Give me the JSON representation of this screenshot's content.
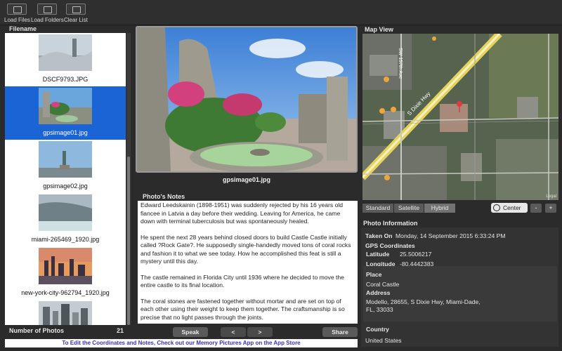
{
  "toolbar": {
    "load_files": "Load Files",
    "load_folders": "Load Folders",
    "clear_list": "Clear List"
  },
  "file_list": {
    "header": "Filename",
    "items": [
      {
        "name": "DSCF9793.JPG",
        "selected": false
      },
      {
        "name": "gpsimage01.jpg",
        "selected": true
      },
      {
        "name": "gpsimage02.jpg",
        "selected": false
      },
      {
        "name": "miami-265469_1920.jpg",
        "selected": false
      },
      {
        "name": "new-york-city-962794_1920.jpg",
        "selected": false
      },
      {
        "name": "",
        "selected": false
      }
    ],
    "count_label": "Number of Photos",
    "count_value": "21"
  },
  "photo": {
    "caption": "gpsimage01.jpg"
  },
  "notes": {
    "title": "Photo's Notes",
    "paragraphs": [
      "Edward Leedskainin (1898-1951) was suddenly rejected by his 16 years old fiancee  in Latvia a day before their wedding. Leaving for America, he came down with terminal tuberculosis but was spontaneously healed.",
      "He spent the next 28 years behind closed doors to build Castle Castle initially called ?Rock Gate?. He supposedly single-handedly moved tons of coral rocks and fashion it to what we see today. How he accomplished this feat is still a mystery until this day.",
      "The castle remained in Florida City until 1936 where he decided to move the entire castle to its final location.",
      "The coral stones are fastened together without mortar and are set on top of each other using their weight to keep them together. The craftsmanship is so precise that no light passes through the joints."
    ]
  },
  "actions": {
    "speak": "Speak",
    "prev": "<",
    "next": ">",
    "share": "Share"
  },
  "map": {
    "title": "Map View",
    "street_1": "S Dixie Hwy",
    "street_2": "SW 157th Ave",
    "legal": "Legal",
    "modes": [
      "Standard",
      "Satellite",
      "Hybrid"
    ],
    "active_mode": "Hybrid",
    "center_label": "Center",
    "zoom_out": "-",
    "zoom_in": "+"
  },
  "info": {
    "title": "Photo Information",
    "taken_on_label": "Taken On",
    "taken_on_value": "Monday, 14 September 2015 6:33:24 PM",
    "gps_label": "GPS Coordinates",
    "latitude_label": "Latitude",
    "latitude_value": "25.5006217",
    "longitude_label": "Longitude",
    "longitude_value": "-80.4442383",
    "place_label": "Place",
    "place_value": "Coral Castle",
    "address_label": "Address",
    "address_line1": "Modello, 28655, S Dixie Hwy, Miami-Dade,",
    "address_line2": "FL, 33033",
    "country_label": "Country",
    "country_value": "United States"
  },
  "footer": {
    "banner": "To Edit the Coordinates and Notes, Check out our Memory Pictures App on the App Store"
  },
  "colors": {
    "selection": "#1a64d6",
    "banner_text": "#3b2fbf"
  }
}
